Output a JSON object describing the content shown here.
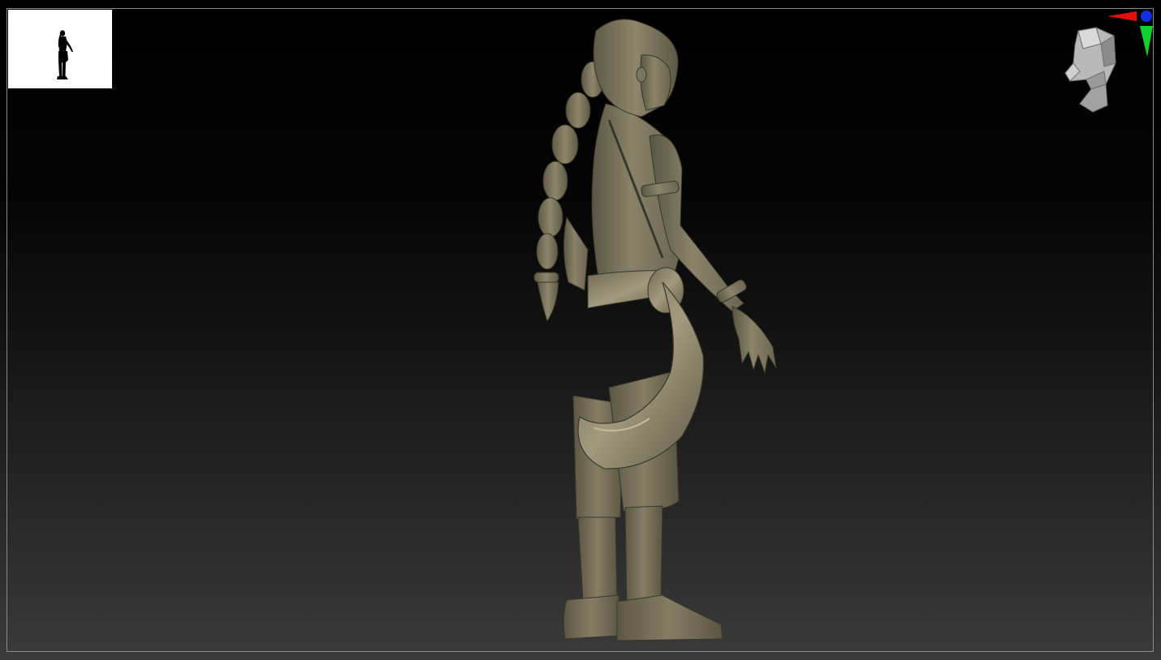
{
  "canvas": {
    "background_top": "#000000",
    "background_bottom": "#3a3a3a",
    "frame_color": "#8a8a8a"
  },
  "navigator": {
    "background": "#ffffff",
    "silhouette_color": "#000000",
    "icon": "figure-silhouette-icon"
  },
  "model": {
    "icon": "sculpted-character-model",
    "material_color": "#7c7660",
    "shadow_color": "#3d3a2c",
    "highlight_color": "#a7a085"
  },
  "gizmo": {
    "icon": "orientation-head-gizmo-icon",
    "x_axis_color": "#e01010",
    "y_axis_color": "#10d030",
    "z_axis_color": "#1030e0",
    "head_color": "#b9b9b9"
  }
}
